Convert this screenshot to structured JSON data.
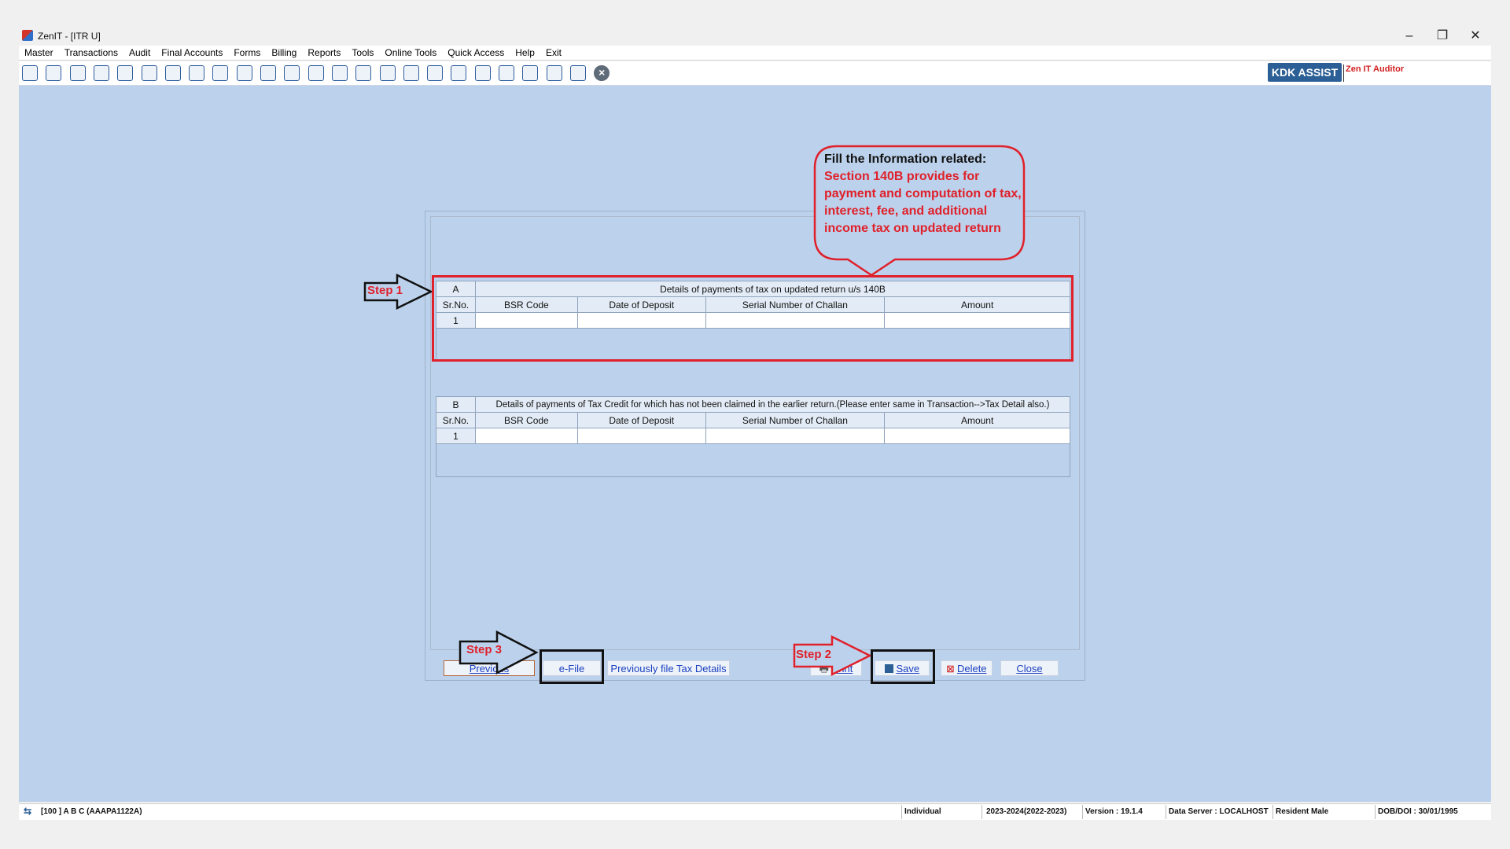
{
  "window": {
    "title": "ZenIT - [ITR U]",
    "minimize": "–",
    "restore": "❐",
    "close": "✕"
  },
  "menu": [
    "Master",
    "Transactions",
    "Audit",
    "Final Accounts",
    "Forms",
    "Billing",
    "Reports",
    "Tools",
    "Online Tools",
    "Quick Access",
    "Help",
    "Exit"
  ],
  "toolbar": {
    "icons": [
      "calendar-icon",
      "home-icon",
      "building-icon",
      "bar-chart-icon",
      "gift-icon",
      "users-icon",
      "pin-icon",
      "filter-icon",
      "tax-icon",
      "sync-icon",
      "calculator-icon",
      "pie-chart-icon",
      "pay-icon",
      "book-icon",
      "info-icon",
      "ledger-icon",
      "report-icon",
      "schedule-icon",
      "refresh-icon",
      "export-icon",
      "bs-icon",
      "tds-icon",
      "tcs-icon",
      "form-icon",
      "close-circle-icon"
    ],
    "kdk_assist": "KDK ASSIST",
    "zen_it_auditor": "Zen IT Auditor"
  },
  "callout": {
    "heading": "Fill the Information related:",
    "body": "Section 140B provides for payment and computation of tax, interest, fee, and additional income tax on updated return"
  },
  "steps": {
    "step1": "Step 1",
    "step2": "Step 2",
    "step3": "Step 3"
  },
  "table_a": {
    "section": "A",
    "title": "Details of payments of tax on updated return u/s 140B",
    "columns": [
      "Sr.No.",
      "BSR Code",
      "Date of Deposit",
      "Serial Number of Challan",
      "Amount"
    ],
    "rows": [
      [
        "1",
        "",
        "",
        "",
        ""
      ]
    ]
  },
  "table_b": {
    "section": "B",
    "title": "Details of payments of Tax Credit for which has not been claimed in the earlier return.(Please enter same in Transaction-->Tax Detail also.)",
    "columns": [
      "Sr.No.",
      "BSR Code",
      "Date of Deposit",
      "Serial Number of Challan",
      "Amount"
    ],
    "rows": [
      [
        "1",
        "",
        "",
        "",
        ""
      ]
    ]
  },
  "buttons": {
    "previous": "Previous",
    "efile": "e-File",
    "previously_filed": "Previously file Tax Details",
    "print": "Print",
    "save": "Save",
    "delete": "Delete",
    "close": "Close"
  },
  "status": {
    "client": "[100 ] A B C (AAAPA1122A)",
    "status_type": "Individual",
    "assessment_year": "2023-2024(2022-2023)",
    "version": "Version : 19.1.4",
    "data_server": "Data Server : LOCALHOST",
    "residency": "Resident Male",
    "dob": "DOB/DOI : 30/01/1995"
  },
  "colors": {
    "workspace": "#bcd2ec",
    "annotation_red": "#e0202a",
    "link_blue": "#1a3fbf",
    "kdk_blue": "#2c5f95"
  }
}
